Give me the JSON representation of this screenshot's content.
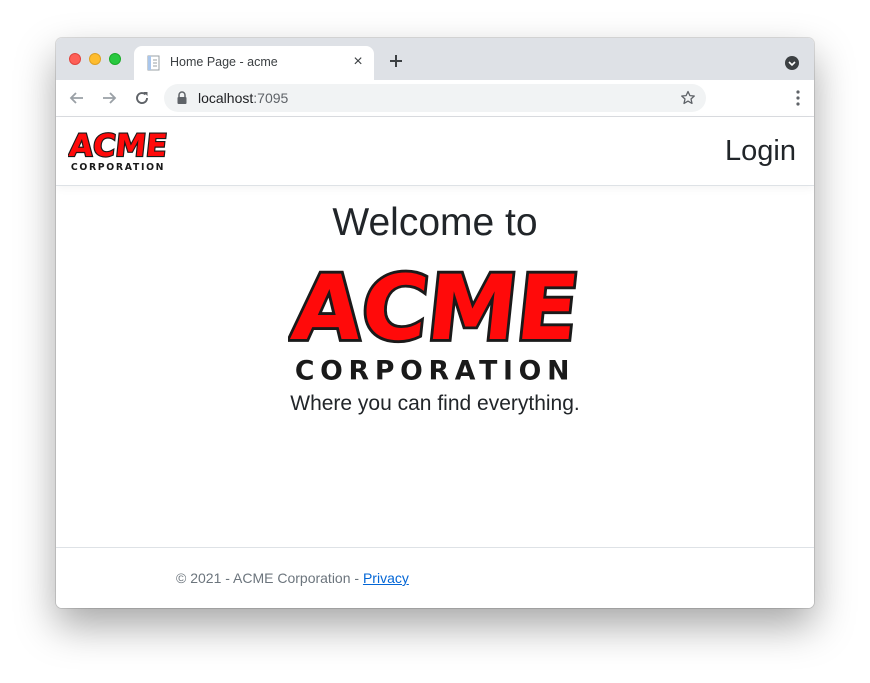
{
  "browser": {
    "tab_title": "Home Page - acme",
    "tab_close": "×",
    "url_host": "localhost",
    "url_port": ":7095"
  },
  "site": {
    "nav": {
      "login_label": "Login"
    },
    "logo": {
      "word": "ACME",
      "sub": "CORPORATION"
    },
    "hero": {
      "welcome": "Welcome to",
      "tagline": "Where you can find everything."
    },
    "footer": {
      "copyright": "© 2021 - ACME Corporation - ",
      "privacy_label": "Privacy"
    }
  },
  "colors": {
    "brand_red": "#ff0a0a",
    "outline": "#1a1a1a",
    "link": "#0366d6"
  }
}
